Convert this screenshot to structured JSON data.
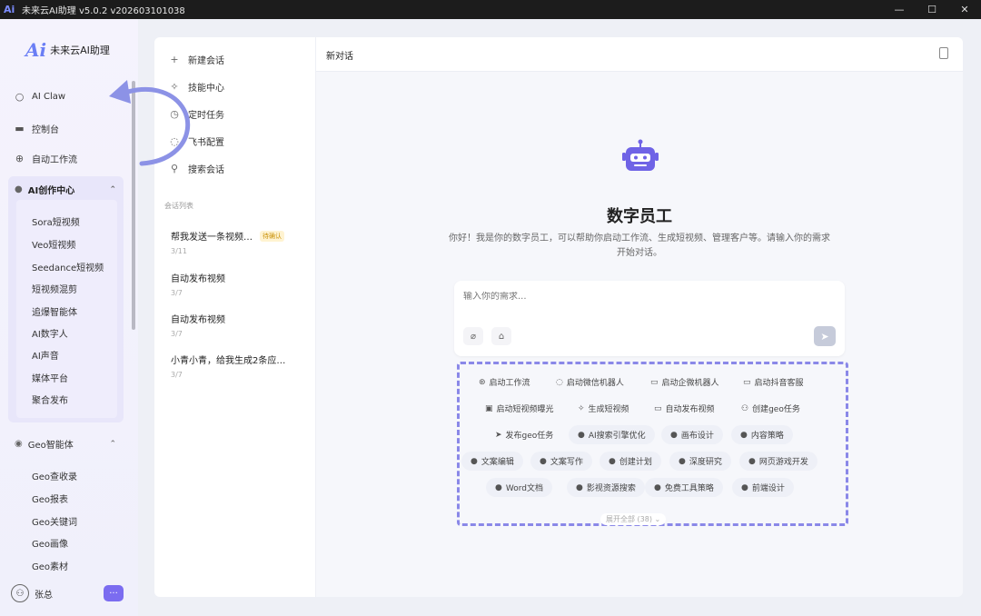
{
  "window": {
    "title": "未来云AI助理 v5.0.2 v202603101038",
    "controls": [
      "—",
      "☐",
      "✕"
    ]
  },
  "brand": {
    "logo": "Ai",
    "name": "未来云AI助理"
  },
  "sidebar": {
    "items": [
      {
        "label": "AI Claw",
        "icon": "chat-bubble-icon"
      },
      {
        "label": "控制台",
        "icon": "monitor-icon"
      },
      {
        "label": "自动工作流",
        "icon": "workflow-icon"
      }
    ],
    "group": {
      "label": "AI创作中心",
      "items": [
        "Sora短视频",
        "Veo短视频",
        "Seedance短视频",
        "短视频混剪",
        "追爆智能体",
        "AI数字人",
        "AI声音",
        "媒体平台",
        "聚合发布"
      ]
    },
    "geo": {
      "label": "Geo智能体",
      "items": [
        "Geo查收录",
        "Geo报表",
        "Geo关键词",
        "Geo画像",
        "Geo素材"
      ]
    },
    "user": {
      "name": "张总",
      "more": "···"
    }
  },
  "middle": {
    "actions": [
      {
        "label": "新建会话",
        "icon": "plus-icon"
      },
      {
        "label": "技能中心",
        "icon": "sparkle-icon"
      },
      {
        "label": "定时任务",
        "icon": "clock-icon"
      },
      {
        "label": "飞书配置",
        "icon": "chat-icon"
      },
      {
        "label": "搜索会话",
        "icon": "search-icon"
      }
    ],
    "section_label": "会话列表",
    "conversations": [
      {
        "title": "帮我发送一条视频…",
        "date": "3/11",
        "badge": "待确认"
      },
      {
        "title": "自动发布视频",
        "date": "3/7"
      },
      {
        "title": "自动发布视频",
        "date": "3/7"
      },
      {
        "title": "小青小青，给我生成2条应…",
        "date": "3/7"
      }
    ]
  },
  "main": {
    "header_title": "新对话",
    "heading": "数字员工",
    "description": "你好！我是你的数字员工，可以帮助你启动工作流、生成短视频、管理客户等。请输入你的需求开始对话。",
    "input_placeholder": "输入你的需求...",
    "expand_label": "展开全部 (38) ⌄",
    "chips": [
      {
        "label": "启动工作流",
        "icon": "workflow-icon"
      },
      {
        "label": "启动微信机器人",
        "icon": "chat-icon"
      },
      {
        "label": "启动企微机器人",
        "icon": "chat-icon"
      },
      {
        "label": "启动抖音客服",
        "icon": "chat-icon"
      },
      {
        "label": "启动短视频曝光",
        "icon": "image-icon"
      },
      {
        "label": "生成短视频",
        "icon": "sparkle-icon"
      },
      {
        "label": "自动发布视频",
        "icon": "video-icon"
      },
      {
        "label": "创建geo任务",
        "icon": "user-icon"
      },
      {
        "label": "发布geo任务",
        "icon": "send-icon"
      },
      {
        "label": "AI搜索引擎优化",
        "icon": "pin-icon"
      },
      {
        "label": "画布设计",
        "icon": "pin-icon"
      },
      {
        "label": "内容策略",
        "icon": "pin-icon"
      },
      {
        "label": "文案编辑",
        "icon": "pin-icon"
      },
      {
        "label": "文案写作",
        "icon": "pin-icon"
      },
      {
        "label": "创建计划",
        "icon": "pin-icon"
      },
      {
        "label": "深度研究",
        "icon": "pin-icon"
      },
      {
        "label": "网页游戏开发",
        "icon": "pin-icon"
      },
      {
        "label": "Word文档",
        "icon": "pin-icon"
      },
      {
        "label": "影视资源搜索",
        "icon": "pin-icon"
      },
      {
        "label": "免费工具策略",
        "icon": "pin-icon"
      },
      {
        "label": "前端设计",
        "icon": "pin-icon"
      }
    ]
  },
  "colors": {
    "accent": "#7b6cf0",
    "dashed_outline": "#8a88e8",
    "arrow": "#8c92e6"
  }
}
